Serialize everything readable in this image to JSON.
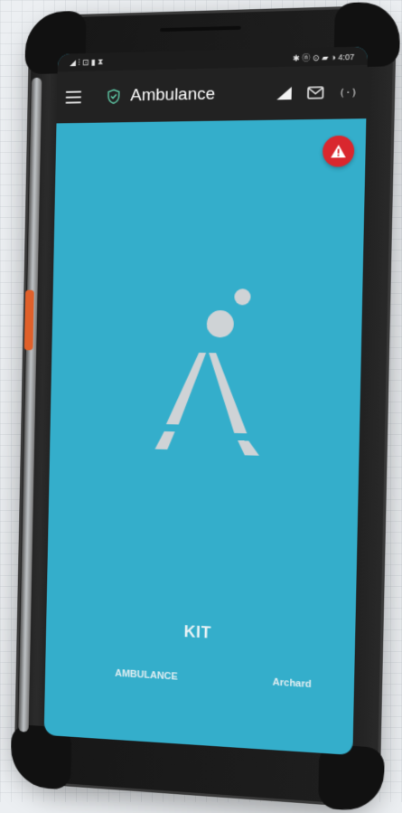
{
  "status_bar": {
    "left": "◢ ⁞ ⊡ ▮ ⧗",
    "right": "✱ ⓝ ⊙ ▰ ◑ 4:07"
  },
  "app_bar": {
    "title": "Ambulance"
  },
  "icons": {
    "menu": "menu-icon",
    "shield": "shield-check-icon",
    "signal": "signal-icon",
    "mail": "mail-icon",
    "radio": "radio-icon",
    "radio_glyph": "(·)",
    "alert": "alert-triangle-icon"
  },
  "colors": {
    "screen_bg": "#34aecb",
    "app_bar_bg": "#222222",
    "alert_red": "#d9272e",
    "logo_gray": "#cfd3d6",
    "shield_green": "#5fc9a6"
  },
  "footer": {
    "kit": "KIT",
    "ambulance": "AMBULANCE",
    "archard": "Archard"
  }
}
